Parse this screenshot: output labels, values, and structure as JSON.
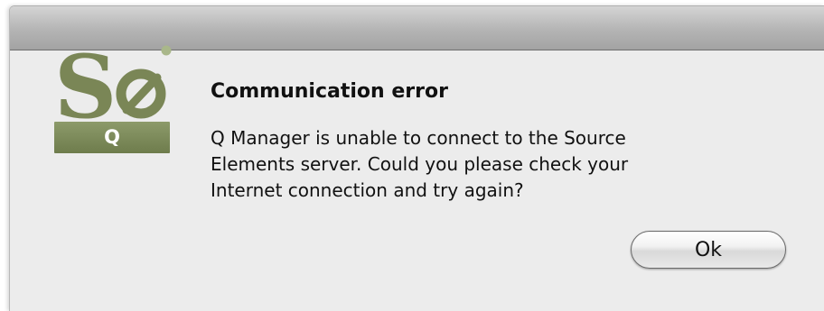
{
  "dialog": {
    "title": "Communication error",
    "message_lines": [
      "Q Manager is unable to connect to the Source",
      "Elements server. Could you please check your",
      "Internet connection and try again?"
    ],
    "ok_label": "Ok"
  },
  "logo": {
    "badge_letter": "Q",
    "icon": "source-elements-logo-icon",
    "colors": {
      "primary": "#7a8656",
      "dot": "#a9b78a"
    }
  }
}
